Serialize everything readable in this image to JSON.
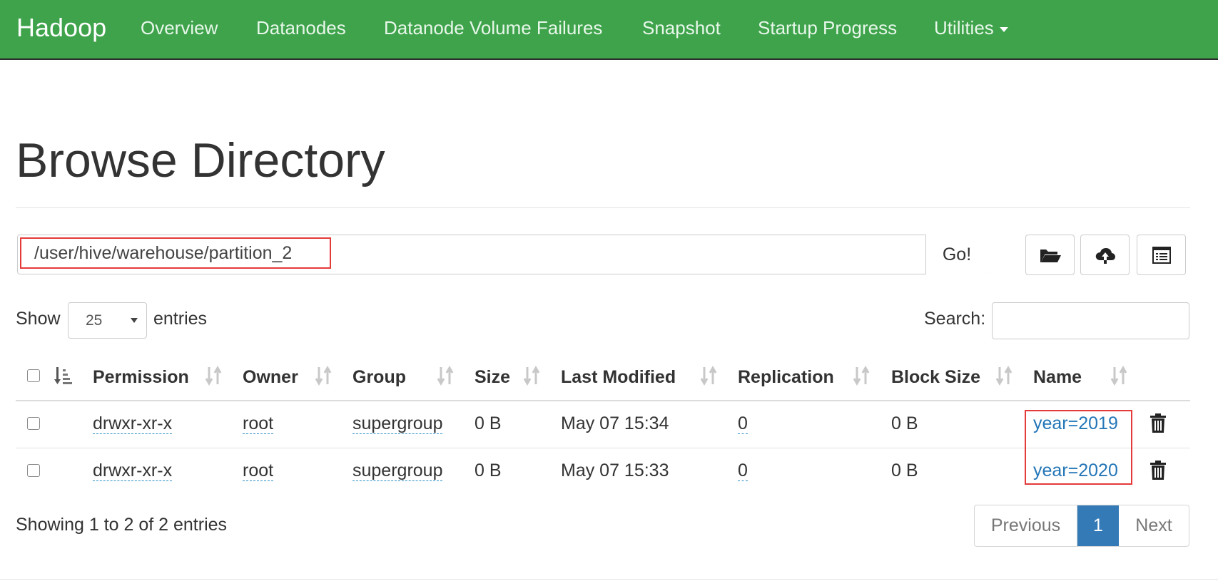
{
  "navbar": {
    "brand": "Hadoop",
    "items": [
      "Overview",
      "Datanodes",
      "Datanode Volume Failures",
      "Snapshot",
      "Startup Progress",
      "Utilities"
    ],
    "bg_color": "#3ea34b"
  },
  "page": {
    "title": "Browse Directory"
  },
  "path_bar": {
    "value": "/user/hive/warehouse/partition_2",
    "go_label": "Go!",
    "icons": [
      "folder-open-icon",
      "cloud-upload-icon",
      "list-alt-icon"
    ]
  },
  "controls": {
    "show_label": "Show",
    "entries_select": "25",
    "entries_label": "entries",
    "search_label": "Search:"
  },
  "table": {
    "columns": [
      "Permission",
      "Owner",
      "Group",
      "Size",
      "Last Modified",
      "Replication",
      "Block Size",
      "Name"
    ],
    "rows": [
      {
        "permission": "drwxr-xr-x",
        "owner": "root",
        "group": "supergroup",
        "size": "0 B",
        "last_modified": "May 07 15:34",
        "replication": "0",
        "block_size": "0 B",
        "name": "year=2019"
      },
      {
        "permission": "drwxr-xr-x",
        "owner": "root",
        "group": "supergroup",
        "size": "0 B",
        "last_modified": "May 07 15:33",
        "replication": "0",
        "block_size": "0 B",
        "name": "year=2020"
      }
    ]
  },
  "footer": {
    "info": "Showing 1 to 2 of 2 entries",
    "previous": "Previous",
    "current_page": "1",
    "next": "Next"
  },
  "colors": {
    "link": "#2376b7",
    "highlight_box": "#e53a3a",
    "active_page": "#337ab7"
  }
}
